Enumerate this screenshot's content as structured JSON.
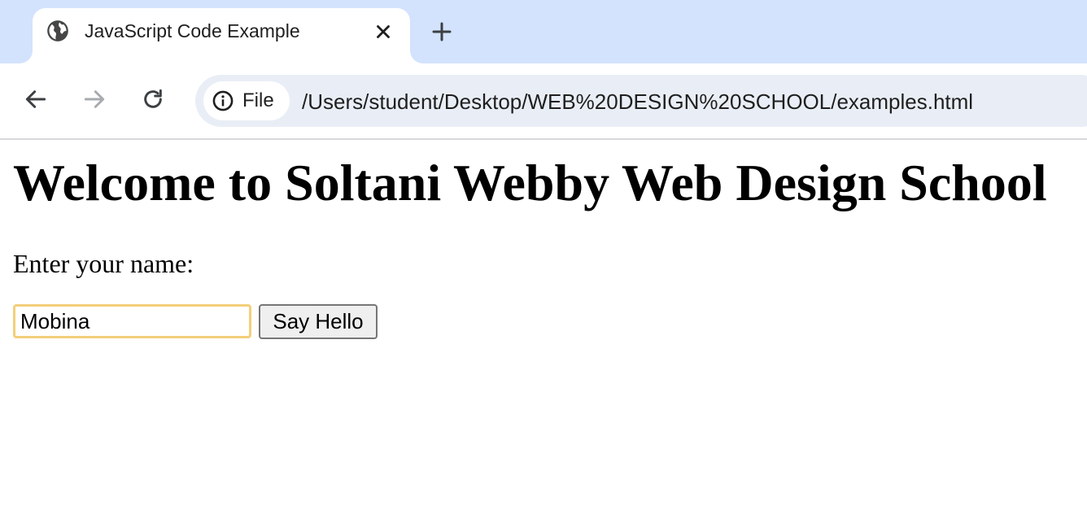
{
  "tab": {
    "title": "JavaScript Code Example",
    "favicon": "globe-icon",
    "close_icon": "close-icon"
  },
  "new_tab_icon": "plus-icon",
  "toolbar": {
    "back_icon": "arrow-left-icon",
    "forward_icon": "arrow-right-icon",
    "reload_icon": "reload-icon",
    "site_chip": {
      "icon": "info-icon",
      "label": "File"
    },
    "url": "/Users/student/Desktop/WEB%20DESIGN%20SCHOOL/examples.html"
  },
  "page": {
    "heading": "Welcome to Soltani Webby Web Design School",
    "prompt_label": "Enter your name:",
    "name_value": "Mobina",
    "button_label": "Say Hello"
  },
  "colors": {
    "tabstrip_bg": "#d3e3fd",
    "omnibox_bg": "#e9eef6",
    "input_focus_border": "#f3cf7a",
    "button_bg": "#efefef",
    "forward_disabled": "#a8abaf"
  }
}
